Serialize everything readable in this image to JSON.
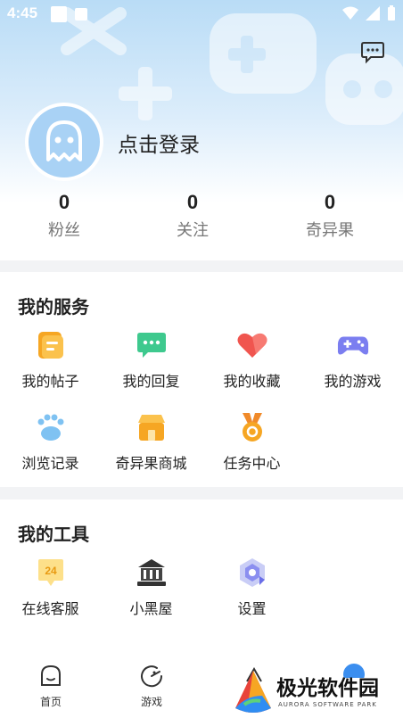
{
  "status_bar": {
    "time": "4:45"
  },
  "profile": {
    "login_text": "点击登录"
  },
  "stats": [
    {
      "value": "0",
      "label": "粉丝"
    },
    {
      "value": "0",
      "label": "关注"
    },
    {
      "value": "0",
      "label": "奇异果"
    }
  ],
  "services": {
    "title": "我的服务",
    "items": [
      {
        "label": "我的帖子",
        "icon": "posts-icon"
      },
      {
        "label": "我的回复",
        "icon": "reply-icon"
      },
      {
        "label": "我的收藏",
        "icon": "heart-icon"
      },
      {
        "label": "我的游戏",
        "icon": "gamepad-icon"
      },
      {
        "label": "浏览记录",
        "icon": "paw-icon"
      },
      {
        "label": "奇异果商城",
        "icon": "shop-icon"
      },
      {
        "label": "任务中心",
        "icon": "medal-icon"
      }
    ]
  },
  "tools": {
    "title": "我的工具",
    "items": [
      {
        "label": "在线客服",
        "icon": "service-24-icon",
        "badge": "24"
      },
      {
        "label": "小黑屋",
        "icon": "building-icon"
      },
      {
        "label": "设置",
        "icon": "settings-icon"
      }
    ]
  },
  "tabbar": {
    "tabs": [
      {
        "label": "首页",
        "icon": "home-icon"
      },
      {
        "label": "游戏",
        "icon": "game-icon"
      }
    ]
  },
  "watermark": {
    "title": "极光软件园",
    "subtitle": "AURORA SOFTWARE PARK"
  },
  "colors": {
    "accent_blue": "#a9d2f5",
    "gamepad": "#7b7ef0",
    "heart": "#f0554f",
    "orange": "#f6a623",
    "green": "#3ec98e"
  }
}
